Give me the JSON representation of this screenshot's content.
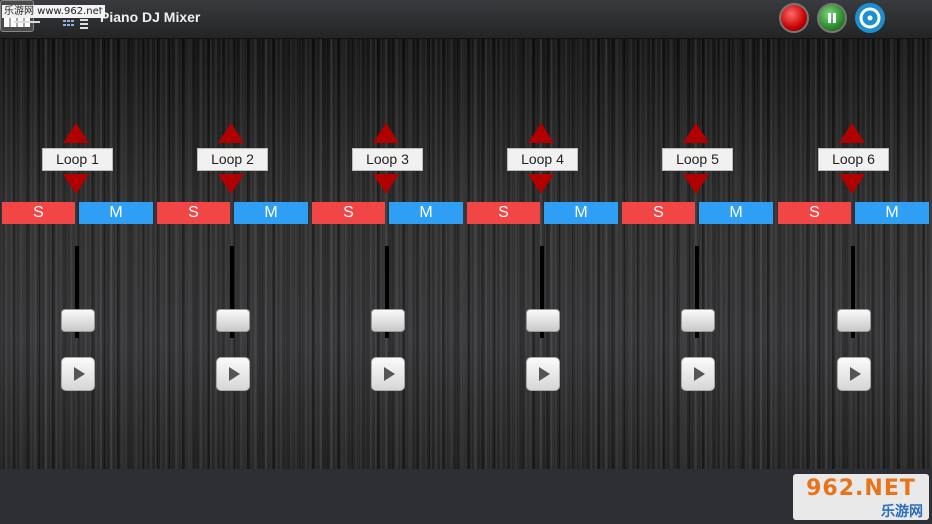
{
  "header": {
    "watermark": "乐游网 www.962.net",
    "title": "Piano DJ Mixer",
    "icons": {
      "menu": "hamburger-icon",
      "view": "grid-list-icon",
      "record": "record-icon",
      "pause": "pause-icon",
      "disc": "disc-icon",
      "piano": "piano-keys-icon"
    }
  },
  "channels": [
    {
      "label": "Loop 1",
      "solo": "S",
      "mute": "M"
    },
    {
      "label": "Loop 2",
      "solo": "S",
      "mute": "M"
    },
    {
      "label": "Loop 3",
      "solo": "S",
      "mute": "M"
    },
    {
      "label": "Loop 4",
      "solo": "S",
      "mute": "M"
    },
    {
      "label": "Loop 5",
      "solo": "S",
      "mute": "M"
    },
    {
      "label": "Loop 6",
      "solo": "S",
      "mute": "M"
    }
  ],
  "colors": {
    "solo": "#f24545",
    "mute": "#2f9ff5",
    "arrow": "#b10000"
  },
  "watermark_br": {
    "top": "962.NET",
    "bottom": "乐游网"
  }
}
